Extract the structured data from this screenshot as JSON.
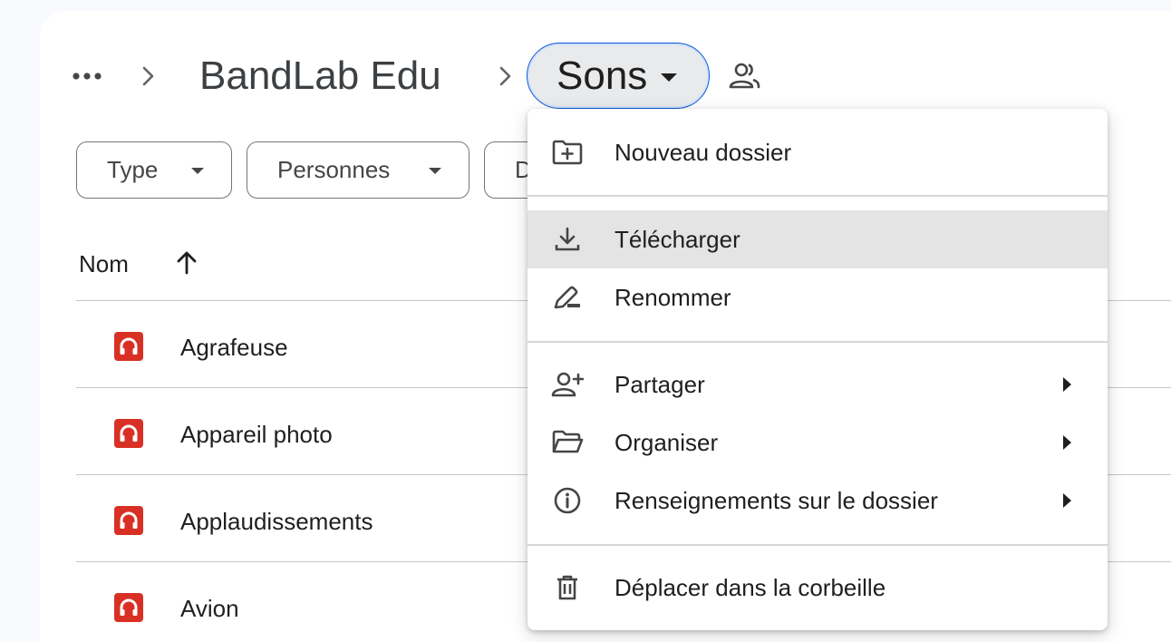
{
  "breadcrumb": {
    "parent": "BandLab Edu",
    "current": "Sons"
  },
  "filters": [
    {
      "label": "Type"
    },
    {
      "label": "Personnes"
    },
    {
      "label": "D"
    }
  ],
  "table": {
    "name_header": "Nom",
    "rows": [
      {
        "name": "Agrafeuse",
        "icon": "audio-file-icon"
      },
      {
        "name": "Appareil photo",
        "icon": "audio-file-icon"
      },
      {
        "name": "Applaudissements",
        "icon": "audio-file-icon"
      },
      {
        "name": "Avion",
        "icon": "audio-file-icon"
      }
    ]
  },
  "menu": {
    "items": [
      {
        "label": "Nouveau dossier",
        "icon": "new-folder-icon"
      },
      {
        "label": "Télécharger",
        "icon": "download-icon",
        "highlighted": true
      },
      {
        "label": "Renommer",
        "icon": "rename-icon"
      },
      {
        "label": "Partager",
        "icon": "add-person-icon",
        "submenu": true
      },
      {
        "label": "Organiser",
        "icon": "folder-open-icon",
        "submenu": true
      },
      {
        "label": "Renseignements sur le dossier",
        "icon": "info-icon",
        "submenu": true
      },
      {
        "label": "Déplacer dans la corbeille",
        "icon": "trash-icon"
      }
    ]
  },
  "colors": {
    "accent": "#0b57d0",
    "audio_icon": "#d93025",
    "menu_highlight": "#e4e4e4"
  }
}
